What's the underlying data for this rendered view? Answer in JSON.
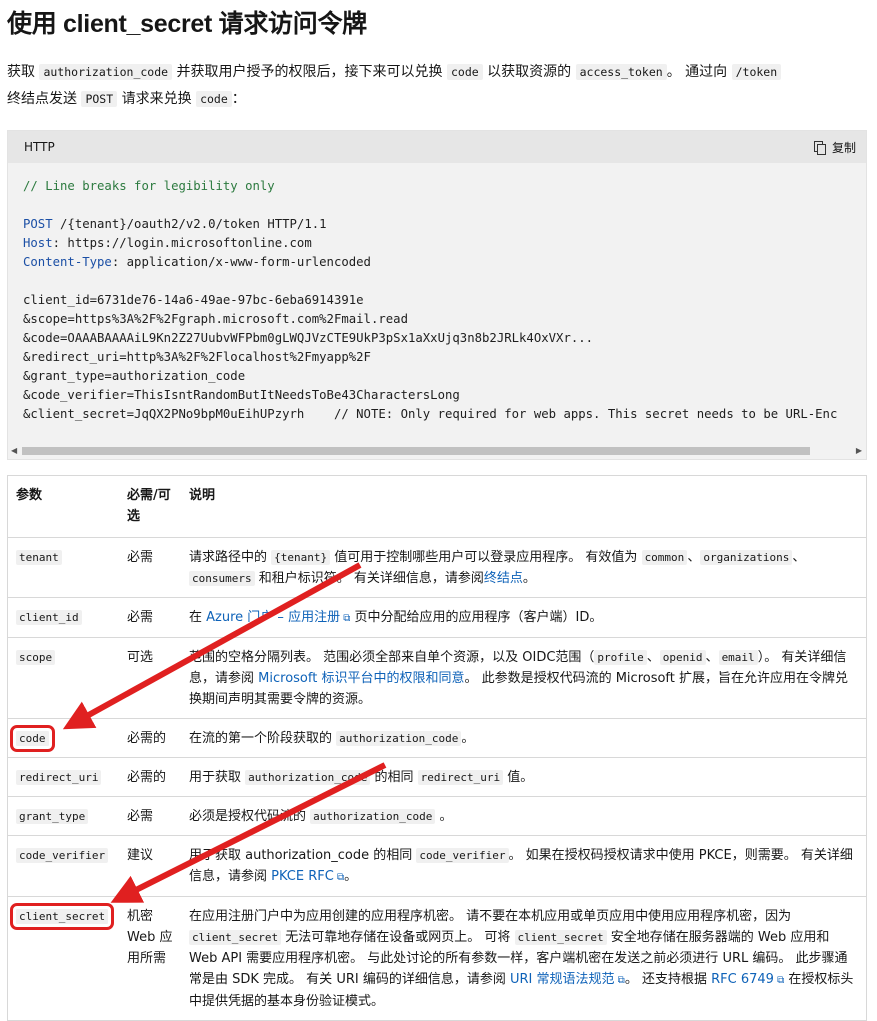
{
  "title": "使用 client_secret 请求访问令牌",
  "intro": {
    "p1": "获取",
    "c1": "authorization_code",
    "p2": "并获取用户授予的权限后，接下来可以兑换",
    "c2": "code",
    "p3": "以获取资源的",
    "c3": "access_token",
    "p4": "。 通过向",
    "c4": "/token",
    "p5": "终结点发送",
    "c5": "POST",
    "p6": "请求来兑换",
    "c6": "code",
    "p7": "："
  },
  "codeblock": {
    "language": "HTTP",
    "copy_label": "复制",
    "lines": {
      "comment": "// Line breaks for legibility only",
      "l_post_kw": "POST",
      "l_post_rest": " /{tenant}/oauth2/v2.0/token HTTP/1.1",
      "l_host_kw": "Host",
      "l_host_rest": ": https://login.microsoftonline.com",
      "l_ct_kw": "Content-Type",
      "l_ct_rest": ": application/x-www-form-urlencoded",
      "l_client_id": "client_id=6731de76-14a6-49ae-97bc-6eba6914391e",
      "l_scope": "&scope=https%3A%2F%2Fgraph.microsoft.com%2Fmail.read",
      "l_code": "&code=OAAABAAAAiL9Kn2Z27UubvWFPbm0gLWQJVzCTE9UkP3pSx1aXxUjq3n8b2JRLk4OxVXr...",
      "l_redirect": "&redirect_uri=http%3A%2F%2Flocalhost%2Fmyapp%2F",
      "l_grant": "&grant_type=authorization_code",
      "l_verifier": "&code_verifier=ThisIsntRandomButItNeedsToBe43CharactersLong",
      "l_secret": "&client_secret=JqQX2PNo9bpM0uEihUPzyrh    // NOTE: Only required for web apps. This secret needs to be URL-Enc"
    }
  },
  "table": {
    "headers": {
      "param": "参数",
      "required": "必需/可选",
      "desc": "说明"
    },
    "rows": {
      "tenant": {
        "name": "tenant",
        "req": "必需",
        "d1": "请求路径中的",
        "c1": "{tenant}",
        "d2": "值可用于控制哪些用户可以登录应用程序。 有效值为",
        "c2": "common",
        "sep1": "、",
        "c3": "organizations",
        "sep2": "、",
        "c4": "consumers",
        "d3": "和租户标识符。 有关详细信息，请参阅",
        "link": "终结点",
        "d4": "。"
      },
      "client_id": {
        "name": "client_id",
        "req": "必需",
        "d1": "在",
        "link": "Azure 门户 – 应用注册",
        "d2": "页中分配给应用的应用程序（客户端）ID。"
      },
      "scope": {
        "name": "scope",
        "req": "可选",
        "d1": "范围的空格分隔列表。 范围必须全部来自单个资源，以及 OIDC范围（",
        "c1": "profile",
        "sep1": "、",
        "c2": "openid",
        "sep2": "、",
        "c3": "email",
        "d2": "）。 有关详细信息，请参阅",
        "link": "Microsoft 标识平台中的权限和同意",
        "d3": "。 此参数是授权代码流的 Microsoft 扩展，旨在允许应用在令牌兑换期间声明其需要令牌的资源。"
      },
      "code": {
        "name": "code",
        "req": "必需的",
        "d1": "在流的第一个阶段获取的",
        "c1": "authorization_code",
        "d2": "。"
      },
      "redirect_uri": {
        "name": "redirect_uri",
        "req": "必需的",
        "d1": "用于获取",
        "c1": "authorization_code",
        "d2": "的相同",
        "c2": "redirect_uri",
        "d3": "值。"
      },
      "grant_type": {
        "name": "grant_type",
        "req": "必需",
        "d1": "必须是授权代码流的",
        "c1": "authorization_code",
        "d2": "。"
      },
      "code_verifier": {
        "name": "code_verifier",
        "req": "建议",
        "d1": "用于获取 authorization_code 的相同",
        "c1": "code_verifier",
        "d2": "。 如果在授权码授权请求中使用 PKCE，则需要。 有关详细信息，请参阅",
        "link": "PKCE RFC",
        "d3": "。"
      },
      "client_secret": {
        "name": "client_secret",
        "req": "机密 Web 应用所需",
        "d1": "在应用注册门户中为应用创建的应用程序机密。 请不要在本机应用或单页应用中使用应用程序机密，因为",
        "c1": "client_secret",
        "d2": "无法可靠地存储在设备或网页上。 可将",
        "c2": "client_secret",
        "d3": "安全地存储在服务器端的 Web 应用和 Web API 需要应用程序机密。 与此处讨论的所有参数一样，客户端机密在发送之前必须进行 URL 编码。 此步骤通常是由 SDK 完成。 有关 URI 编码的详细信息，请参阅",
        "link1": "URI 常规语法规范",
        "d4": "。 还支持根据",
        "link2": "RFC 6749",
        "d5": "在授权标头中提供凭据的基本身份验证模式。"
      }
    }
  },
  "colors": {
    "annotation": "#e02020",
    "link": "#0e62b8",
    "code_keyword": "#1b4fa5",
    "code_comment": "#2c7a3f"
  }
}
